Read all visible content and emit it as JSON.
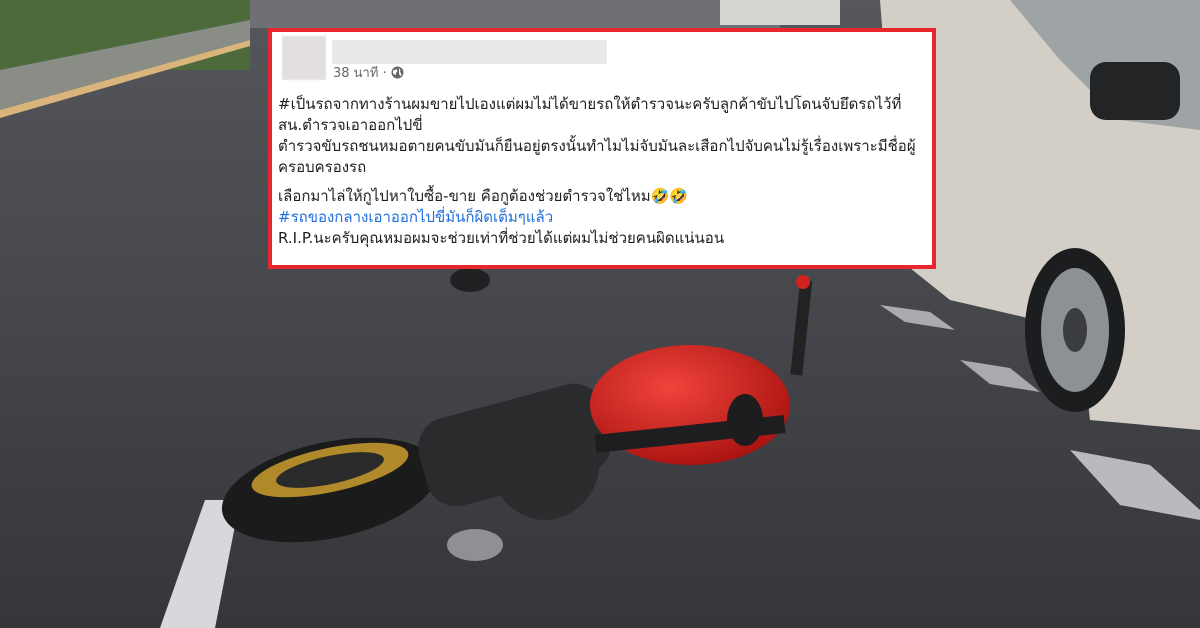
{
  "post": {
    "time": "38 นาที ·",
    "paragraph1_line1": "#เป็นรถจากทางร้านผมขายไปเองแต่ผมไม่ได้ขายรถให้ตำรวจนะครับลูกค้าขับไปโดนจับยึดรถไว้ที่",
    "paragraph1_line2": "สน.ตำรวจเอาออกไปขี่",
    "paragraph1_line3": "ตำรวจขับรถชนหมอตายคนขับมันก็ยืนอยู่ตรงนั้นทำไมไม่จับมันละเสือกไปจับคนไม่รู้เรื่องเพราะมีชื่อผู้",
    "paragraph1_line4": "ครอบครองรถ",
    "paragraph2_line1": "เลือกมาไล่ให้กูไปหาใบซื้อ-ขาย คือกูต้องช่วยตำรวจใช่ไหม🤣🤣",
    "hashtag": "#รถของกลางเอาออกไปขี่มันก็ผิดเต็มๆแล้ว",
    "paragraph2_line3": "R.I.P.นะครับคุณหมอผมจะช่วยเท่าที่ช่วยได้แต่ผมไม่ช่วยคนผิดแน่นอน"
  },
  "colors": {
    "frame": "#e8262b",
    "hashtag": "#216fdb",
    "motorcycle": "#d9231f"
  },
  "icons": [
    "globe-icon"
  ]
}
